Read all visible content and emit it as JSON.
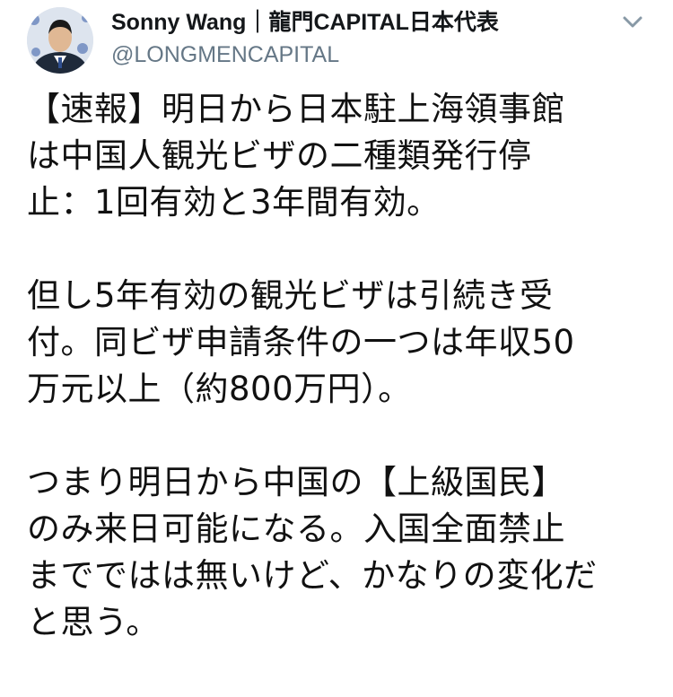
{
  "tweet": {
    "author_name": "Sonny Wang｜龍門CAPITAL日本代表",
    "handle": "@LONGMENCAPITAL",
    "paragraphs": [
      [
        "【速報】明日から日本駐上海領事館",
        "は中国人観光ビザの二種類発行停",
        "止：1回有効と3年間有効。"
      ],
      [
        "但し5年有効の観光ビザは引続き受",
        "付。同ビザ申請条件の一つは年収50",
        "万元以上（約800万円）。"
      ],
      [
        "つまり明日から中国の【上級国民】",
        "のみ来日可能になる。入国全面禁止",
        "までではは無いけど、かなりの変化だ",
        "と思う。"
      ]
    ]
  },
  "icons": {
    "menu": "chevron-down-icon",
    "avatar": "avatar"
  },
  "colors": {
    "text": "#14171a",
    "handle": "#657786",
    "chevron": "#8899a6"
  }
}
